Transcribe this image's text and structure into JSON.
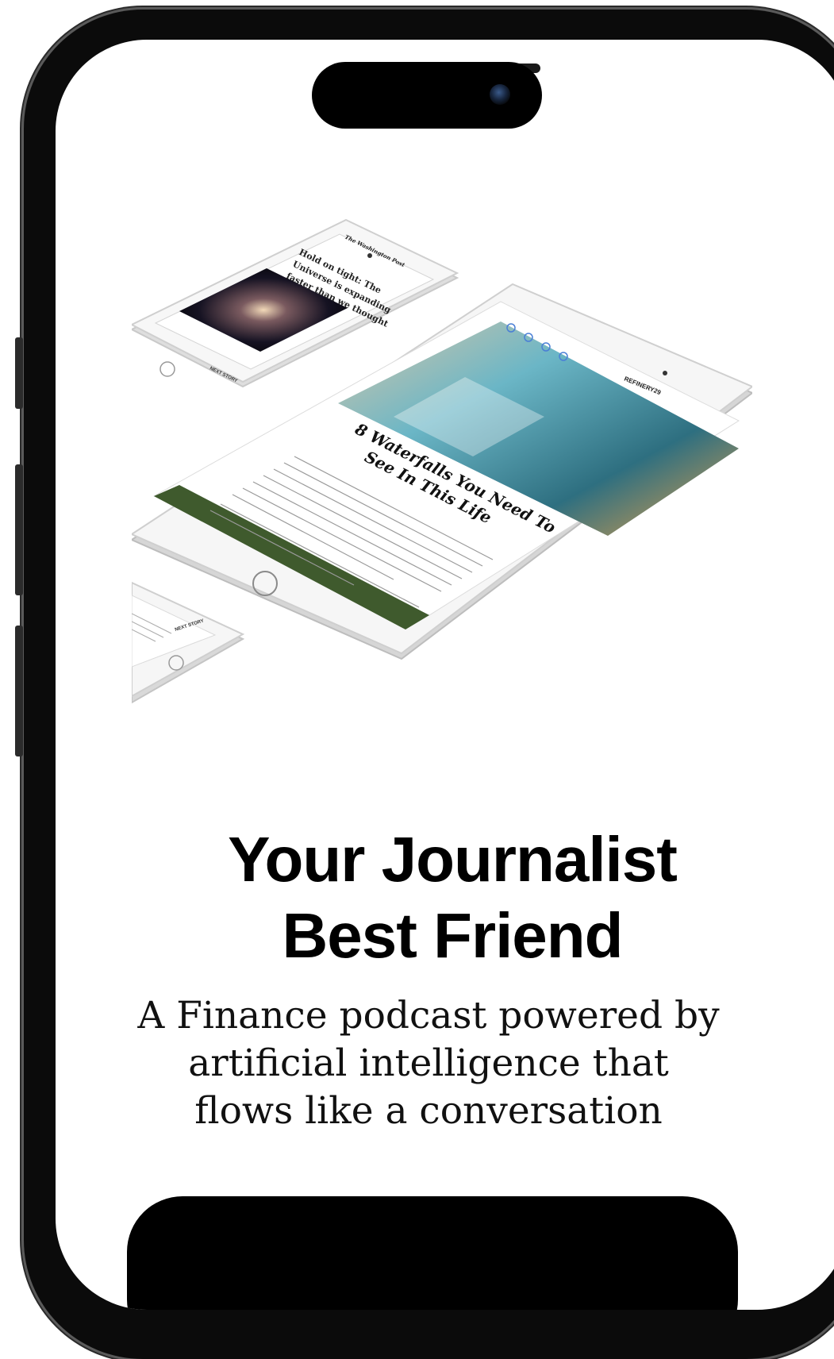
{
  "onboarding": {
    "title_line1": "Your Journalist",
    "title_line2": "Best Friend",
    "subtitle": "A Finance podcast powered by artificial intelligence that flows like a conversation"
  },
  "illustration": {
    "tablet_headline_line1": "8 Waterfalls You Need To",
    "tablet_headline_line2": "See In This Life",
    "tablet_brand": "REFINERY29",
    "phone_headline_line1": "Hold on tight: The",
    "phone_headline_line2": "Universe is expanding",
    "phone_headline_line3": "faster than we thought",
    "phone_masthead": "The Washington Post",
    "next_story": "NEXT STORY"
  },
  "colors": {
    "background": "#ffffff",
    "text": "#000000",
    "button": "#000000"
  }
}
